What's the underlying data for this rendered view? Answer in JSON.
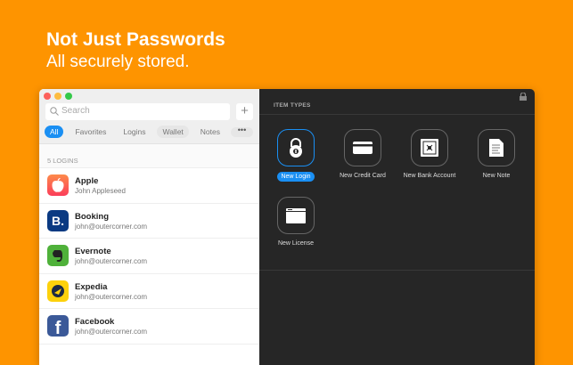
{
  "headline": "Not Just Passwords",
  "subheadline": "All securely stored.",
  "search": {
    "placeholder": "Search"
  },
  "add_label": "+",
  "tabs": [
    "All",
    "Favorites",
    "Logins",
    "Wallet",
    "Notes"
  ],
  "more_label": "•••",
  "list_header": "5 LOGINS",
  "logins": [
    {
      "name": "Apple",
      "email": "John Appleseed",
      "letter": "",
      "color": "#fc5a46"
    },
    {
      "name": "Booking",
      "email": "john@outercorner.com",
      "letter": "B.",
      "color": "#0a3a82"
    },
    {
      "name": "Evernote",
      "email": "john@outercorner.com",
      "letter": "",
      "color": "#4fb13a"
    },
    {
      "name": "Expedia",
      "email": "john@outercorner.com",
      "letter": "",
      "color": "#fdd10c"
    },
    {
      "name": "Facebook",
      "email": "john@outercorner.com",
      "letter": "f",
      "color": "#3b5998"
    }
  ],
  "panel": {
    "title": "ITEM TYPES",
    "items": [
      "New Login",
      "New Credit Card",
      "New Bank Account",
      "New Note",
      "New License"
    ]
  },
  "accent": "#1a8ff3"
}
